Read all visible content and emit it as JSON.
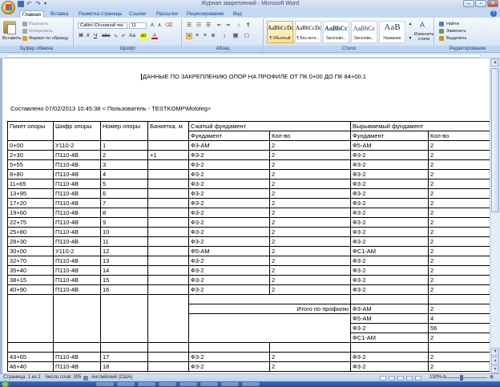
{
  "window": {
    "title": "Журнал закреплений - Microsoft Word",
    "controls": {
      "minimize": "–",
      "maximize": "▫",
      "close": "✕"
    }
  },
  "tabs": [
    "Главная",
    "Вставка",
    "Разметка страницы",
    "Ссылки",
    "Рассылки",
    "Рецензирование",
    "Вид"
  ],
  "ribbon": {
    "clipboard": {
      "paste": "Вставить",
      "cut": "Вырезать",
      "copy": "Копировать",
      "format_painter": "Формат по образцу",
      "group_label": "Буфер обмена"
    },
    "font": {
      "font_name": "Calibri (Основной тек",
      "font_size": "11",
      "group_label": "Шрифт"
    },
    "paragraph": {
      "group_label": "Абзац"
    },
    "styles": {
      "items": [
        {
          "sample": "AaBbCcDc",
          "name": "¶ Обычный"
        },
        {
          "sample": "AaBbCcDc",
          "name": "¶ Без инте..."
        },
        {
          "sample": "AaBbCc",
          "name": "Заголово..."
        },
        {
          "sample": "AaBbCc",
          "name": "Заголово..."
        },
        {
          "sample": "AaB",
          "name": "Название"
        }
      ],
      "change_styles": "Изменить стили",
      "group_label": "Стили"
    },
    "editing": {
      "find": "Найти",
      "replace": "Заменить",
      "select": "Выделить",
      "group_label": "Редактирование"
    }
  },
  "document": {
    "heading": "ДАННЫЕ ПО ЗАКРЕПЛЕНИЮ ОПОР НА ПРОФИЛЕ ОТ ПК 0+00 ДО ПК 84+00.1",
    "compiled": "Составлено 07/02/2013 10:45:38   < Пользователь - TESTKOMP\\Mololeg>",
    "table": {
      "header": {
        "picket": "Пикет опоры",
        "cipher": "Шифр опоры",
        "number": "Номер опоры",
        "banketka": "Банкетка, м",
        "compressed": "Сжатый фундамент",
        "pulled": "Вырываемый фундамент",
        "foundation": "Фундамент",
        "count": "Кол-во"
      },
      "rows": [
        [
          "0+00",
          "У110-2",
          "1",
          "",
          "Ф3-АМ",
          "2",
          "Ф5-АМ",
          "2"
        ],
        [
          "2+30",
          "П110-4В",
          "2",
          "+1",
          "Ф3-2",
          "2",
          "Ф3-2",
          "2"
        ],
        [
          "5+55",
          "П110-4В",
          "3",
          "",
          "Ф3-2",
          "2",
          "Ф3-2",
          "2"
        ],
        [
          "8+80",
          "П110-4В",
          "4",
          "",
          "Ф3-2",
          "2",
          "Ф3-2",
          "2"
        ],
        [
          "11+65",
          "П110-4В",
          "5",
          "",
          "Ф3-2",
          "2",
          "Ф3-2",
          "2"
        ],
        [
          "13+95",
          "П110-4В",
          "6",
          "",
          "Ф3-2",
          "2",
          "Ф3-2",
          "2"
        ],
        [
          "17+20",
          "П110-4В",
          "7",
          "",
          "Ф3-2",
          "2",
          "Ф3-2",
          "2"
        ],
        [
          "19+60",
          "П110-4В",
          "8",
          "",
          "Ф3-2",
          "2",
          "Ф3-2",
          "2"
        ],
        [
          "22+75",
          "П110-4В",
          "9",
          "",
          "Ф3-2",
          "2",
          "Ф3-2",
          "2"
        ],
        [
          "25+80",
          "П110-4В",
          "10",
          "",
          "Ф3-2",
          "2",
          "Ф3-2",
          "2"
        ],
        [
          "28+30",
          "П110-4В",
          "11",
          "",
          "Ф3-2",
          "2",
          "Ф3-2",
          "2"
        ],
        [
          "30+00",
          "У110-2",
          "12",
          "",
          "Ф5-АМ",
          "2",
          "ФС1-АМ",
          "2"
        ],
        [
          "32+70",
          "П110-4В",
          "13",
          "",
          "Ф3-2",
          "2",
          "Ф3-2",
          "2"
        ],
        [
          "35+40",
          "П110-4В",
          "14",
          "",
          "Ф3-2",
          "2",
          "Ф3-2",
          "2"
        ],
        [
          "38+15",
          "П110-4В",
          "15",
          "",
          "Ф3-2",
          "2",
          "Ф3-2",
          "2"
        ],
        [
          "40+90",
          "П110-4В",
          "16",
          "",
          "Ф3-2",
          "2",
          "Ф3-2",
          "2"
        ]
      ],
      "totals": {
        "label": "Итого по профилю",
        "items": [
          [
            "Ф3-АМ",
            "2"
          ],
          [
            "Ф5-АМ",
            "4"
          ],
          [
            "Ф3-2",
            "56"
          ],
          [
            "ФС1-АМ",
            "2"
          ]
        ]
      },
      "rows_after": [
        [
          "43+65",
          "П110-4В",
          "17",
          "",
          "Ф3-2",
          "2",
          "Ф3-2",
          "2"
        ],
        [
          "46+40",
          "П110-4В",
          "18",
          "",
          "Ф3-2",
          "2",
          "Ф3-2",
          "2"
        ]
      ]
    }
  },
  "status": {
    "page": "Страница: 1 из 2",
    "words": "Число слов: 305",
    "language": "Английский (США)",
    "zoom": "130%"
  }
}
